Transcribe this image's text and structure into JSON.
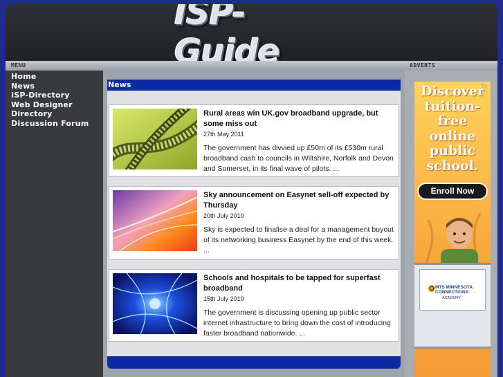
{
  "site": {
    "logo_text": "ISP-Guide"
  },
  "labels": {
    "menu": "MENU",
    "adverts": "ADVERTS"
  },
  "nav": [
    {
      "label": "Home"
    },
    {
      "label": "News"
    },
    {
      "label": "ISP-Directory"
    },
    {
      "label": "Web Designer"
    },
    {
      "label": "Directory"
    },
    {
      "label": "Discussion Forum"
    }
  ],
  "news": {
    "heading": "News",
    "articles": [
      {
        "headline": "Rural areas win UK.gov broadband upgrade, but some miss out",
        "date": "27th May 2011",
        "summary": "The government has divvied up £50m of its £530m rural broadband cash to councils in Wiltshire, Norfolk and Devon and Somerset, in its final wave of pilots. ..."
      },
      {
        "headline": "Sky announcement on Easynet sell-off expected by Thursday",
        "date": "20th July 2010",
        "summary": "Sky is expected to finalise a deal for a management buyout of its networking business Easynet by the end of this week. ..."
      },
      {
        "headline": "Schools and hospitals to be tapped for superfast broadband",
        "date": "15th July 2010",
        "summary": "The government is discussing opening up public sector internet infrastructure to bring down the cost of introducing faster broadband nationwide. ..."
      }
    ]
  },
  "ad": {
    "headline_lines": [
      "Discover",
      "tuition-",
      "free",
      "online",
      "public",
      "school."
    ],
    "cta": "Enroll Now",
    "brand": "MTS MINNESOTA CONNECTIONS",
    "academy": "ACADEMY",
    "adchoices_icon": "play-triangle"
  },
  "colors": {
    "page_bg": "#1f2c8f",
    "news_blue": "#0e2aa3",
    "sidebar": "#383a3e",
    "ad_orange": "#f8a53a"
  }
}
